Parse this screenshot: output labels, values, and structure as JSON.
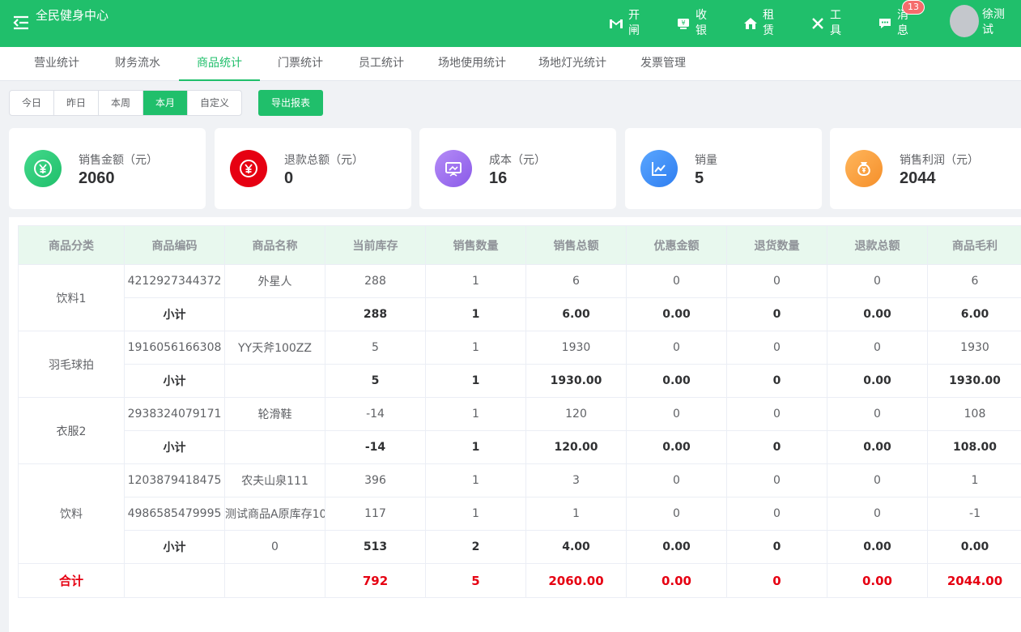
{
  "app": {
    "title": "全民健身中心"
  },
  "nav": [
    {
      "label": "开闸",
      "icon": "gate-icon"
    },
    {
      "label": "收银",
      "icon": "cashier-icon"
    },
    {
      "label": "租赁",
      "icon": "rental-icon"
    },
    {
      "label": "工具",
      "icon": "tools-icon"
    },
    {
      "label": "消息",
      "icon": "message-icon",
      "badge": "13"
    }
  ],
  "user": {
    "name": "徐测试"
  },
  "tabs": [
    "营业统计",
    "财务流水",
    "商品统计",
    "门票统计",
    "员工统计",
    "场地使用统计",
    "场地灯光统计",
    "发票管理"
  ],
  "active_tab": "商品统计",
  "filters": {
    "ranges": [
      "今日",
      "昨日",
      "本周",
      "本月",
      "自定义"
    ],
    "selected": "本月",
    "export_label": "导出报表"
  },
  "stats": [
    {
      "label": "销售金额（元）",
      "value": "2060",
      "color": "#20bf6b",
      "icon": "yuan-icon"
    },
    {
      "label": "退款总额（元）",
      "value": "0",
      "color": "#e60012",
      "icon": "yuan-icon"
    },
    {
      "label": "成本（元）",
      "value": "16",
      "color": "#9b6cf0",
      "icon": "presentation-icon"
    },
    {
      "label": "销量",
      "value": "5",
      "color": "#3b8cf7",
      "icon": "line-chart-icon"
    },
    {
      "label": "销售利润（元）",
      "value": "2044",
      "color": "#f7a23b",
      "icon": "money-bag-icon"
    }
  ],
  "table": {
    "columns": [
      "商品分类",
      "商品编码",
      "商品名称",
      "当前库存",
      "销售数量",
      "销售总额",
      "优惠金额",
      "退货数量",
      "退款总额",
      "商品毛利"
    ],
    "groups": [
      {
        "category": "饮料1",
        "items": [
          [
            "4212927344372",
            "外星人",
            "288",
            "1",
            "6",
            "0",
            "0",
            "0",
            "6"
          ]
        ],
        "subtotal": [
          "小计",
          "",
          "288",
          "1",
          "6.00",
          "0.00",
          "0",
          "0.00",
          "6.00"
        ]
      },
      {
        "category": "羽毛球拍",
        "items": [
          [
            "1916056166308",
            "YY天斧100ZZ",
            "5",
            "1",
            "1930",
            "0",
            "0",
            "0",
            "1930"
          ]
        ],
        "subtotal": [
          "小计",
          "",
          "5",
          "1",
          "1930.00",
          "0.00",
          "0",
          "0.00",
          "1930.00"
        ]
      },
      {
        "category": "衣服2",
        "items": [
          [
            "2938324079171",
            "轮滑鞋",
            "-14",
            "1",
            "120",
            "0",
            "0",
            "0",
            "108"
          ]
        ],
        "subtotal": [
          "小计",
          "",
          "-14",
          "1",
          "120.00",
          "0.00",
          "0",
          "0.00",
          "108.00"
        ]
      },
      {
        "category": "饮料",
        "items": [
          [
            "1203879418475",
            "农夫山泉111",
            "396",
            "1",
            "3",
            "0",
            "0",
            "0",
            "1"
          ],
          [
            "4986585479995",
            "测试商品A原库存10",
            "117",
            "1",
            "1",
            "0",
            "0",
            "0",
            "-1"
          ]
        ],
        "subtotal": [
          "小计",
          "0",
          "513",
          "2",
          "4.00",
          "0.00",
          "0",
          "0.00",
          "0.00"
        ]
      }
    ],
    "total": [
      "合计",
      "",
      "",
      "792",
      "5",
      "2060.00",
      "0.00",
      "0",
      "0.00",
      "2044.00"
    ]
  }
}
